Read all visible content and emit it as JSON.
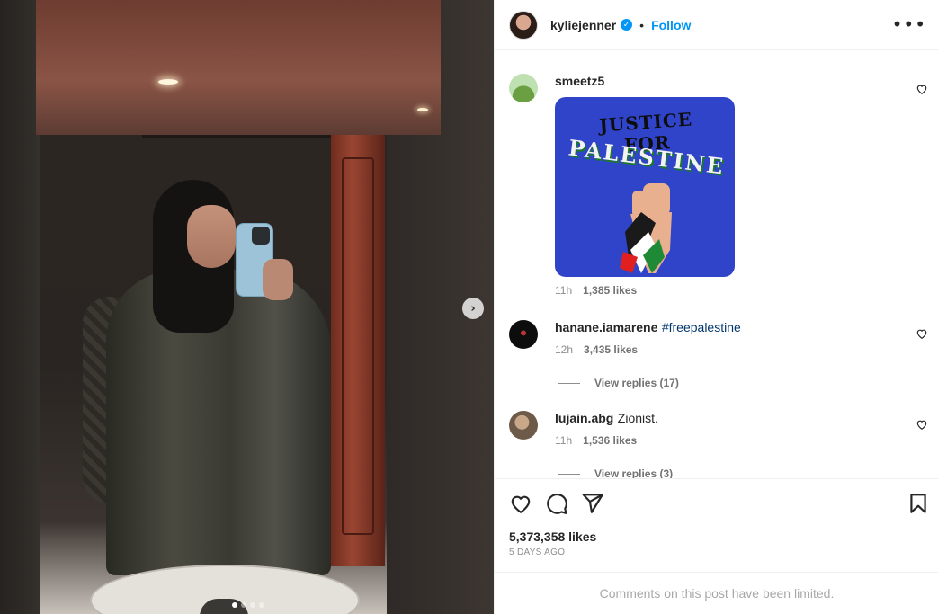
{
  "post": {
    "username": "kyliejenner",
    "verified_mark": "✓",
    "separator": "•",
    "follow_label": "Follow",
    "more_icon": "•••",
    "next_icon": "›",
    "likes": "5,373,358 likes",
    "date": "5 DAYS AGO",
    "comments_limited": "Comments on this post have been limited."
  },
  "comments": [
    {
      "user": "smeetz5",
      "text": "",
      "tag": "",
      "time": "11h",
      "likes": "1,385 likes",
      "sticker": {
        "line1": "JUSTICE FOR",
        "line2": "PALESTINE"
      }
    },
    {
      "user": "hanane.iamarene",
      "text": "",
      "tag": "#freepalestine",
      "time": "12h",
      "likes": "3,435 likes",
      "replies": "View replies (17)"
    },
    {
      "user": "lujain.abg",
      "text": "Zionist.",
      "tag": "",
      "time": "11h",
      "likes": "1,536 likes",
      "replies": "View replies (3)"
    }
  ],
  "icons": {
    "like": "heart-icon",
    "comment": "comment-icon",
    "share": "send-icon",
    "save": "bookmark-icon"
  },
  "colors": {
    "accent": "#0095f6",
    "hashtag": "#00376b",
    "sticker_bg": "#2f44c8"
  }
}
